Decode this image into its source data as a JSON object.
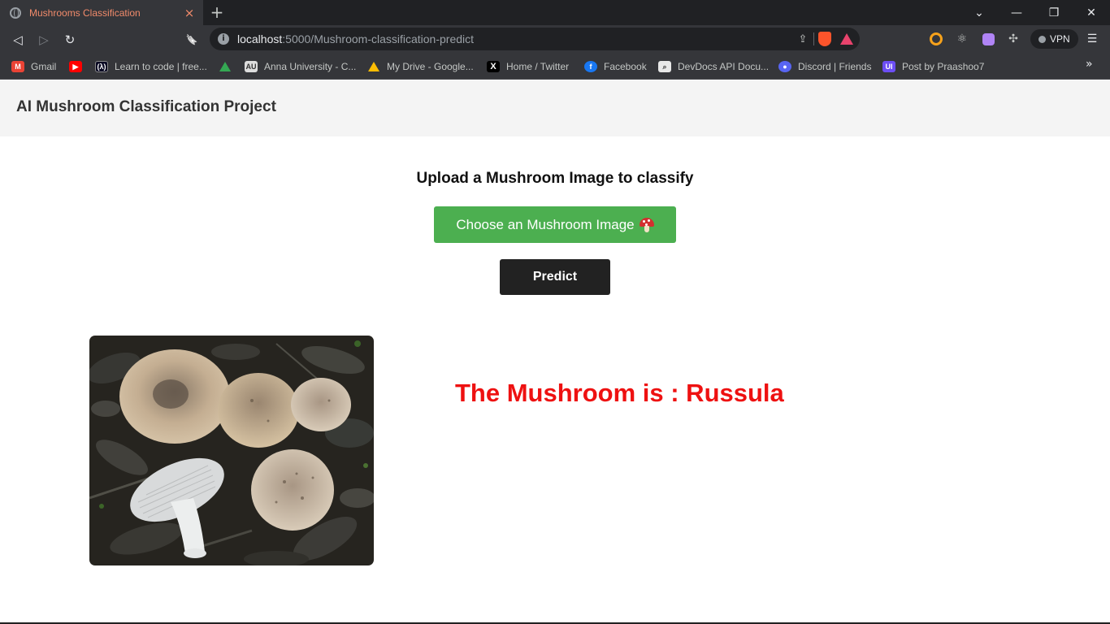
{
  "browser": {
    "tab": {
      "title": "Mushrooms Classification",
      "close": "×"
    },
    "new_tab": "+",
    "window_controls": {
      "dropdown": "⌄",
      "minimize": "—",
      "restore": "❐",
      "close": "✕"
    },
    "nav": {
      "back": "◁",
      "forward": "▷",
      "reload": "↻",
      "bookmark": "🔖"
    },
    "address": {
      "host": "localhost",
      "path": ":5000/Mushroom-classification-predict"
    },
    "vpn_label": "VPN",
    "menu": "☰",
    "bookmarks": [
      {
        "label": "Gmail",
        "icon": "gmail-icon"
      },
      {
        "label": "",
        "icon": "youtube-icon"
      },
      {
        "label": "Learn to code | free...",
        "icon": "freecodecamp-icon"
      },
      {
        "label": "",
        "icon": "google-drive-icon"
      },
      {
        "label": "Anna University - C...",
        "icon": "anna-university-icon"
      },
      {
        "label": "My Drive - Google...",
        "icon": "google-drive-icon"
      },
      {
        "label": "Home / Twitter",
        "icon": "x-twitter-icon"
      },
      {
        "label": "Facebook",
        "icon": "facebook-icon"
      },
      {
        "label": "DevDocs API Docu...",
        "icon": "devdocs-icon"
      },
      {
        "label": "Discord | Friends",
        "icon": "discord-icon"
      },
      {
        "label": "Post by Praashoo7",
        "icon": "ui-icon"
      }
    ],
    "bookmarks_more": "»"
  },
  "page": {
    "header_title": "AI Mushroom Classification Project",
    "upload_title": "Upload a Mushroom Image to classify",
    "choose_button": "Choose an Mushroom Image",
    "predict_button": "Predict",
    "result_text": "The Mushroom is : Russula"
  },
  "colors": {
    "choose_button": "#4caf50",
    "predict_button": "#222222",
    "result_text": "#ee1111",
    "header_bg": "#f4f4f4"
  }
}
